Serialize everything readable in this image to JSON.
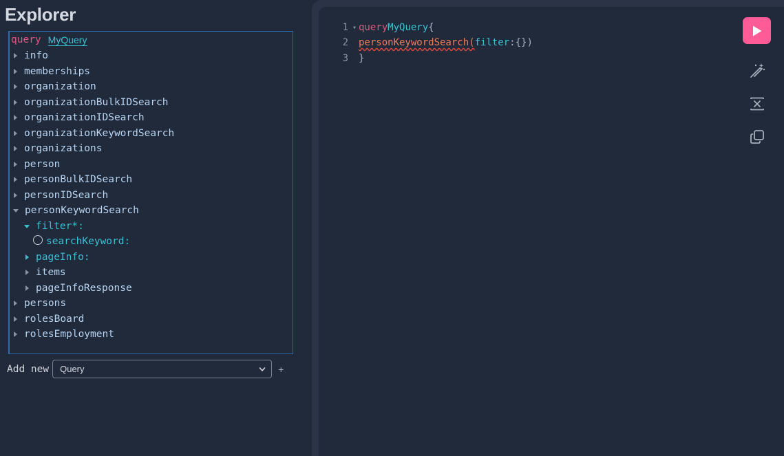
{
  "explorer": {
    "title": "Explorer",
    "operation_keyword": "query",
    "operation_name": "MyQuery",
    "tree": [
      {
        "label": "info",
        "expanded": false
      },
      {
        "label": "memberships",
        "expanded": false
      },
      {
        "label": "organization",
        "expanded": false
      },
      {
        "label": "organizationBulkIDSearch",
        "expanded": false
      },
      {
        "label": "organizationIDSearch",
        "expanded": false
      },
      {
        "label": "organizationKeywordSearch",
        "expanded": false
      },
      {
        "label": "organizations",
        "expanded": false
      },
      {
        "label": "person",
        "expanded": false
      },
      {
        "label": "personBulkIDSearch",
        "expanded": false
      },
      {
        "label": "personIDSearch",
        "expanded": false
      },
      {
        "label": "personKeywordSearch",
        "expanded": true
      },
      {
        "label": "filter*:",
        "expanded": true
      },
      {
        "label": "searchKeyword:",
        "checked": false
      },
      {
        "label": "pageInfo:",
        "expanded": false
      },
      {
        "label": "items",
        "expanded": false
      },
      {
        "label": "pageInfoResponse",
        "expanded": false
      },
      {
        "label": "persons",
        "expanded": false
      },
      {
        "label": "rolesBoard",
        "expanded": false
      },
      {
        "label": "rolesEmployment",
        "expanded": false
      }
    ],
    "add_new": {
      "label": "Add new",
      "selected": "Query",
      "plus": "+"
    }
  },
  "editor": {
    "lines": [
      {
        "number": "1",
        "tokens": [
          "query",
          "MyQuery",
          "{"
        ]
      },
      {
        "number": "2",
        "tokens": [
          "personKeywordSearch(",
          "filter",
          ":",
          "{})"
        ]
      },
      {
        "number": "3",
        "tokens": [
          "}"
        ]
      }
    ]
  },
  "toolbar": {
    "run_icon": "play-icon",
    "prettify_icon": "magic-wand-icon",
    "merge_icon": "merge-fragments-icon",
    "copy_icon": "copy-icon"
  },
  "colors": {
    "background": "#212a3b",
    "panel": "#2b3446",
    "accent_pink": "#ff5c97",
    "keyword": "#e2567f",
    "name": "#39c1d4",
    "field": "#b8d4f1",
    "error_field": "#f07b5b",
    "selection_border": "#2f6bb0"
  }
}
